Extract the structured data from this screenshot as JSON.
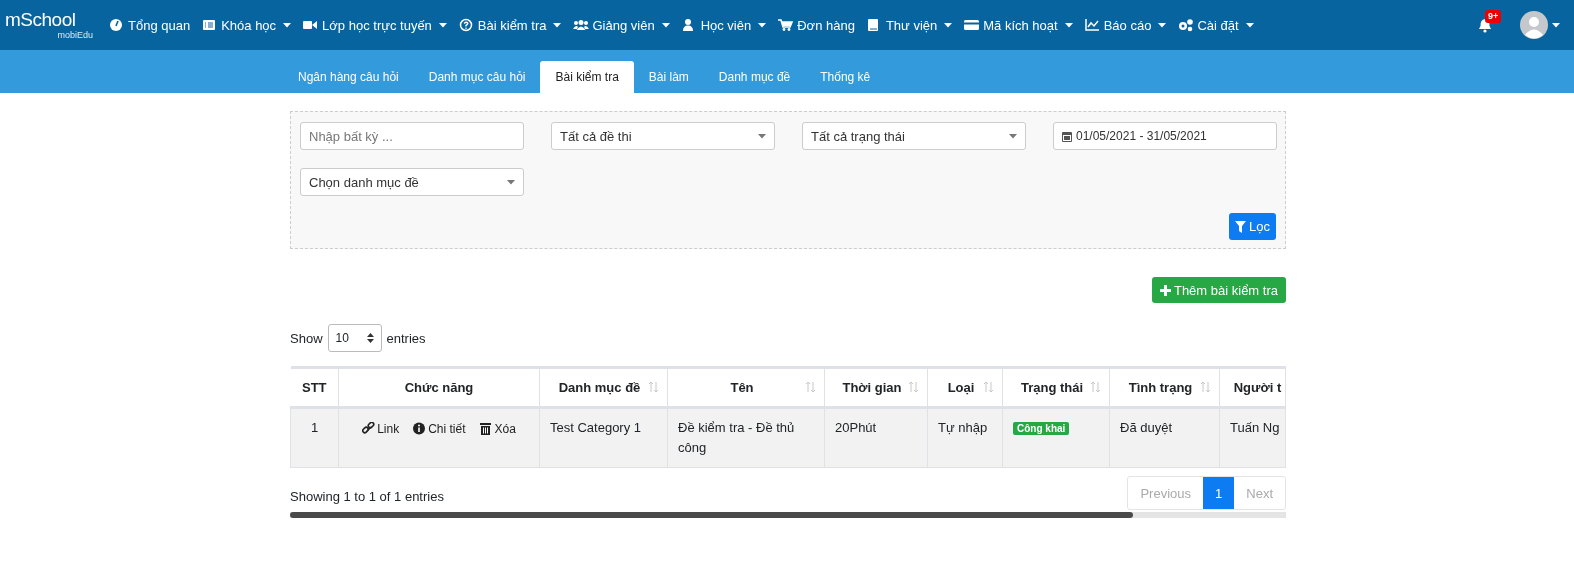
{
  "logo": {
    "main": "mSchool",
    "sub": "mobiEdu"
  },
  "nav": [
    {
      "label": "Tổng quan",
      "has_menu": false
    },
    {
      "label": "Khóa học",
      "has_menu": true
    },
    {
      "label": "Lớp học trực tuyến",
      "has_menu": true
    },
    {
      "label": "Bài kiểm tra",
      "has_menu": true
    },
    {
      "label": "Giảng viên",
      "has_menu": true
    },
    {
      "label": "Học viên",
      "has_menu": true
    },
    {
      "label": "Đơn hàng",
      "has_menu": false
    },
    {
      "label": "Thư viện",
      "has_menu": true
    },
    {
      "label": "Mã kích hoạt",
      "has_menu": true
    },
    {
      "label": "Báo cáo",
      "has_menu": true
    },
    {
      "label": "Cài đặt",
      "has_menu": true
    }
  ],
  "notifications": {
    "badge": "9+"
  },
  "tabs": [
    {
      "label": "Ngân hàng câu hỏi",
      "selected": false
    },
    {
      "label": "Danh mục câu hỏi",
      "selected": false
    },
    {
      "label": "Bài kiểm tra",
      "selected": true
    },
    {
      "label": "Bài làm",
      "selected": false
    },
    {
      "label": "Danh mục đề",
      "selected": false
    },
    {
      "label": "Thống kê",
      "selected": false
    }
  ],
  "filters": [
    {
      "kind": "text",
      "placeholder": "Nhập bất kỳ ..."
    },
    {
      "kind": "select",
      "value": "Tất cả đề thi"
    },
    {
      "kind": "select",
      "value": "Tất cả trạng thái"
    },
    {
      "kind": "date",
      "value": "01/05/2021 - 31/05/2021"
    },
    {
      "kind": "select",
      "value": "Chọn danh mục đề"
    }
  ],
  "filter_button": "Lọc",
  "add_button": "Thêm bài kiểm tra",
  "length": {
    "before": "Show",
    "value": "10",
    "after": "entries"
  },
  "table": {
    "columns": [
      {
        "label": "STT",
        "sortable": false
      },
      {
        "label": "Chức năng",
        "sortable": false
      },
      {
        "label": "Danh mục đề",
        "sortable": true
      },
      {
        "label": "Tên",
        "sortable": true
      },
      {
        "label": "Thời gian",
        "sortable": true
      },
      {
        "label": "Loại",
        "sortable": true
      },
      {
        "label": "Trạng thái",
        "sortable": true
      },
      {
        "label": "Tình trạng",
        "sortable": true
      },
      {
        "label": "Người t",
        "sortable": false
      }
    ],
    "rows": [
      {
        "stt": "1",
        "actions": [
          {
            "kind": "link",
            "label": "Link"
          },
          {
            "kind": "info",
            "label": "Chi tiết"
          },
          {
            "kind": "delete",
            "label": "Xóa"
          }
        ],
        "category": "Test Category 1",
        "name": "Đề kiểm tra - Đề thủ công",
        "duration": "20Phút",
        "type": "Tự nhập",
        "status": "Công khai",
        "state": "Đã duyệt",
        "author": "Tuấn Ng"
      }
    ]
  },
  "info": "Showing 1 to 1 of 1 entries",
  "pagination": [
    {
      "label": "Previous",
      "kind": "prev",
      "selected": false
    },
    {
      "label": "1",
      "kind": "page",
      "selected": true
    },
    {
      "label": "Next",
      "kind": "next",
      "selected": false
    }
  ]
}
